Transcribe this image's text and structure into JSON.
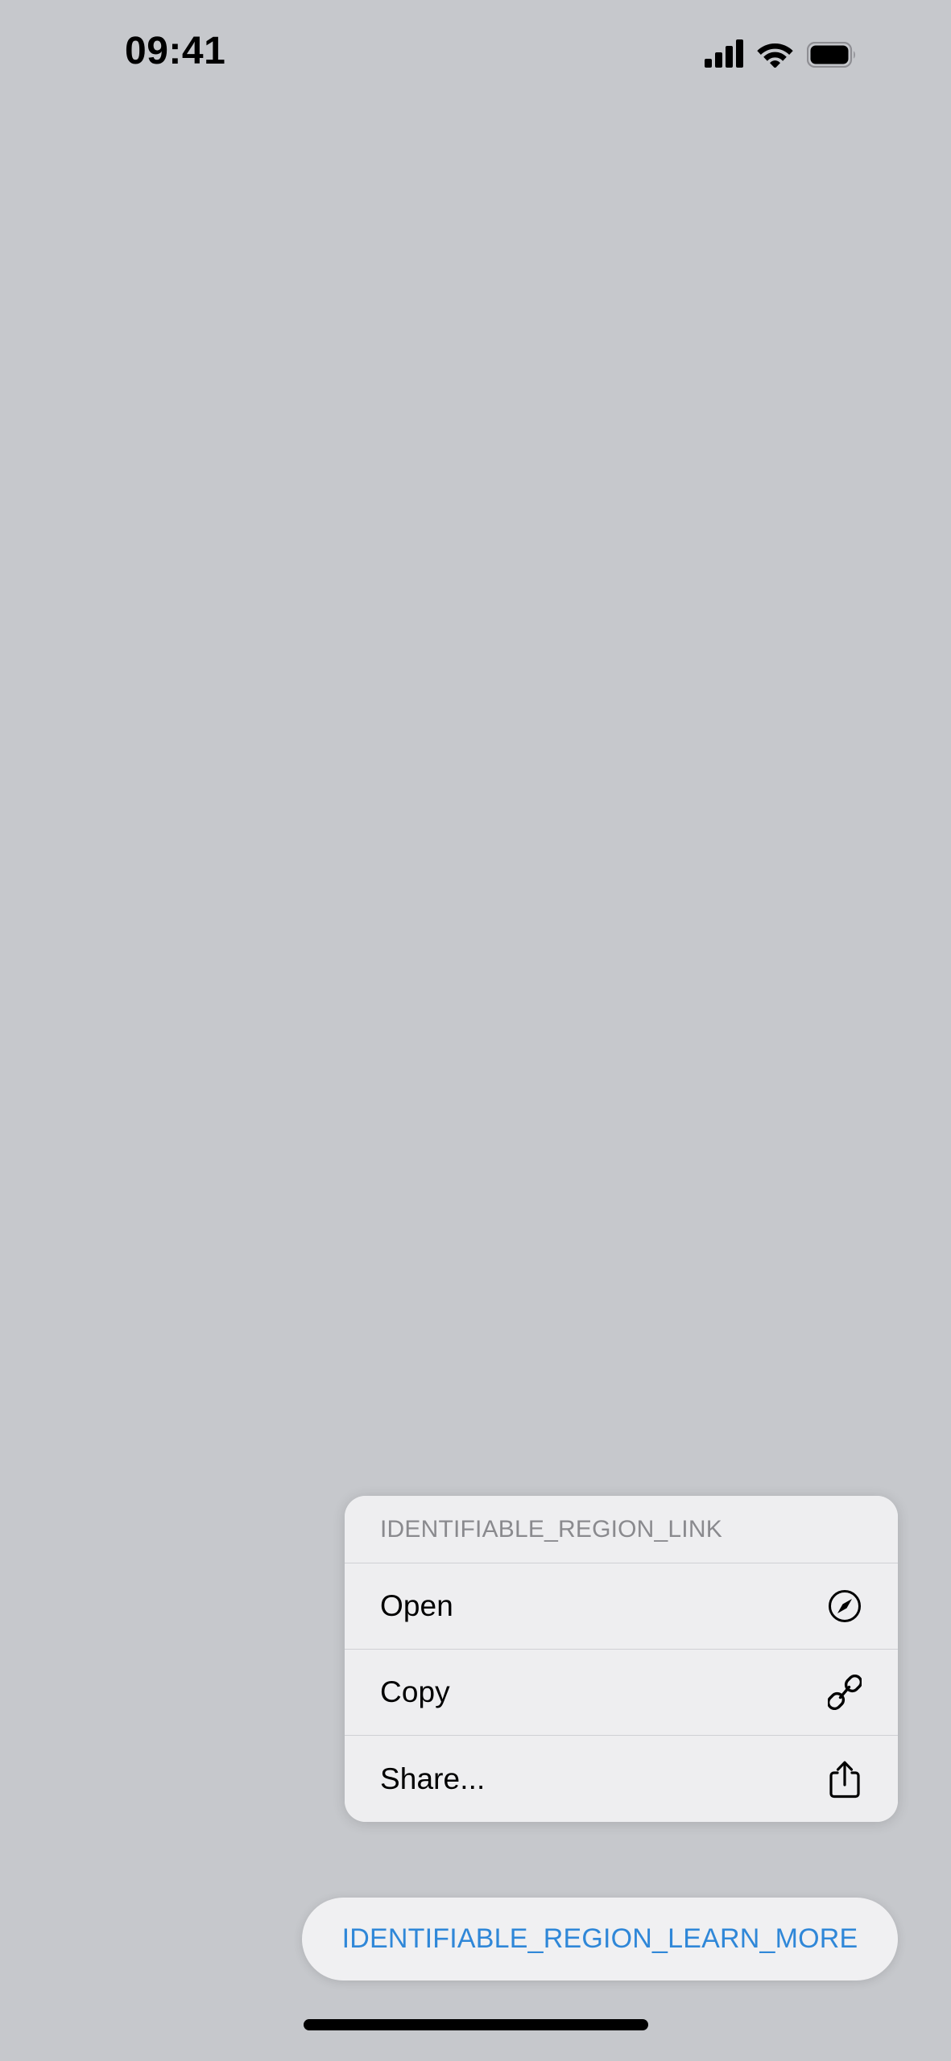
{
  "theme": {
    "background_color": "#c6c8cc",
    "sheet_color": "#eeeef0",
    "separator_color": "#cfd0d4",
    "accent_color": "#2f87d8",
    "header_text_color": "#8a8a8e",
    "label_color": "#000000"
  },
  "status_bar": {
    "time": "09:41",
    "icons": {
      "cellular": "cellular-signal-icon",
      "wifi": "wifi-icon",
      "battery": "battery-icon"
    }
  },
  "action_sheet": {
    "header": "IDENTIFIABLE_REGION_LINK",
    "items": [
      {
        "label": "Open",
        "icon": "compass-icon"
      },
      {
        "label": "Copy",
        "icon": "link-icon"
      },
      {
        "label": "Share...",
        "icon": "share-icon"
      }
    ]
  },
  "learn_more_button": {
    "label": "IDENTIFIABLE_REGION_LEARN_MORE"
  },
  "home_indicator": {
    "name": "home-indicator"
  }
}
